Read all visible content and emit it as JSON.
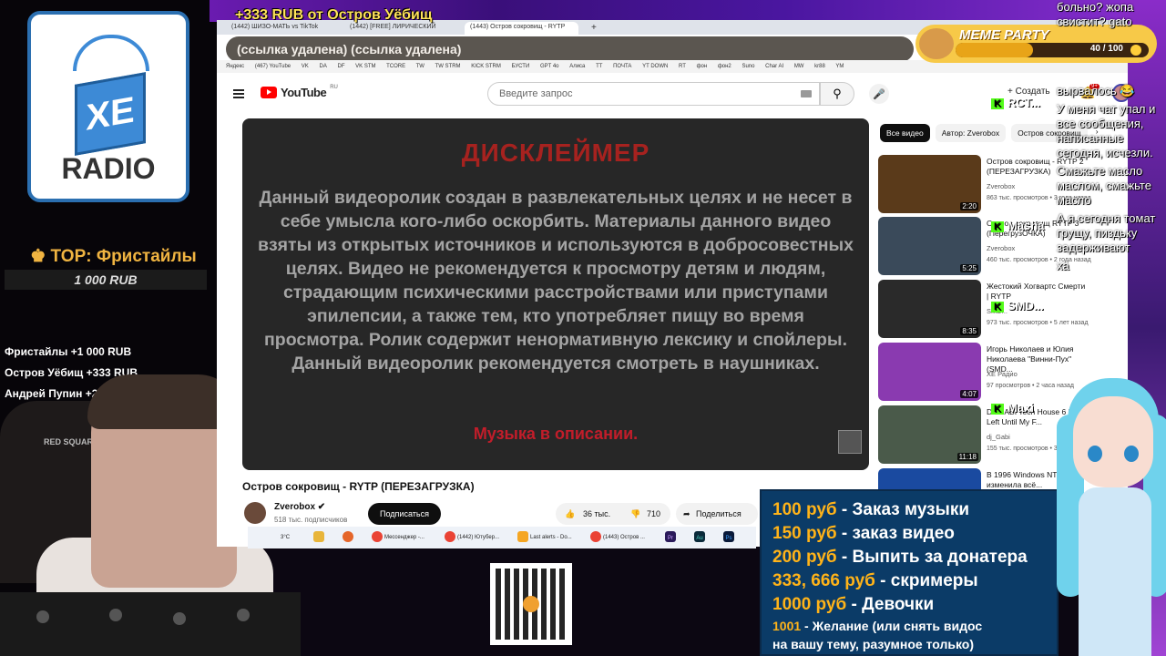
{
  "stream_overlay": {
    "logo": {
      "mark": "XE",
      "text": "RADIO"
    },
    "top_donor": {
      "title": "TOP: Фристайлы",
      "amount": "1 000 RUB"
    },
    "recent_donations": [
      "Фристайлы +1 000 RUB",
      "Остров Уёбищ +333 RUB",
      "Андрей Пупин +20"
    ],
    "chair_brand": "RED SQUARE",
    "donate_banner": "+333 RUB  от Остров Уёбищ",
    "meme_party": {
      "title": "MEME PARTY",
      "value": "40 / 100",
      "progress": 0.4
    },
    "price_list": [
      {
        "price": "100 руб",
        "text": " - Заказ музыки"
      },
      {
        "price": "150 руб",
        "text": " - заказ видео"
      },
      {
        "price": "200 руб",
        "text": " - Выпить за донатера"
      },
      {
        "price": "333, 666 руб",
        "text": " - скримеры"
      },
      {
        "price": "1000 руб",
        "text": " - Девочки"
      },
      {
        "price": "1001",
        "text": " - Желание (или снять видос"
      },
      {
        "price": "",
        "text": "на вашу тему, разумное только)"
      }
    ],
    "chat_messages": [
      "больно? жопа свистит? gato",
      "вырвалось 😂",
      "У меня чат упал и все сообщения, написанные сегодня, исчезли.",
      "Смажьте масло маслом, смажьте масло",
      "А я сегодня томат грущу, пиздьку задерживают",
      "ха"
    ],
    "kick_users": [
      "RCT...",
      "Masha",
      "SMD...",
      "Maxi"
    ]
  },
  "browser": {
    "tabs": [
      {
        "label": "(1442) ШИЗО-МАТЬ vs TikTok",
        "active": false
      },
      {
        "label": "(1442) [FREE] ЛИРИЧЕСКИЙ",
        "active": false
      },
      {
        "label": "(1443) Остров сокровищ - RYTP",
        "active": true
      }
    ],
    "address": "(ссылка удалена) (ссылка удалена)",
    "bookmarks": [
      "Яндекс",
      "(467) YouTube",
      "VK",
      "DA",
      "DF",
      "VK STM",
      "TCORE",
      "TW",
      "TW STRM",
      "KICK STRM",
      "БУСТИ",
      "GPT 4o",
      "Алиса",
      "TT",
      "ПОЧТА",
      "YT DOWN",
      "RT",
      "фон",
      "фон2",
      "Suno",
      "Char AI",
      "MW",
      "kr88",
      "YM"
    ]
  },
  "youtube": {
    "logo_text": "YouTube",
    "region": "RU",
    "search_placeholder": "Введите запрос",
    "create_label": "Создать",
    "notifications": "9+",
    "video": {
      "disclaimer_title": "ДИСКЛЕЙМЕР",
      "disclaimer_text": "Данный видеоролик создан в развлекательных целях и не несет в себе умысла кого-либо оскорбить. Материалы данного видео взяты из открытых источников и используются в добросовестных целях. Видео не рекомендуется к просмотру детям и людям, страдающим психическими расстройствами или приступами эпилепсии, а также тем, кто употребляет пищу во время просмотра. Ролик содержит ненормативную лексику и спойлеры. Данный видеоролик рекомендуется смотреть в наушниках.",
      "disclaimer_music": "Музыка в описании.",
      "title": "Остров сокровищ - RYTP (ПЕРЕЗАГРУЗКА)",
      "channel": "Zverobox",
      "subscribers": "518 тыс. подписчиков",
      "subscribe_label": "Подписаться",
      "likes": "36 тыс.",
      "dislikes": "710",
      "share_label": "Поделиться"
    },
    "chips": [
      {
        "label": "Все видео",
        "active": true
      },
      {
        "label": "Автор: Zverobox",
        "active": false
      },
      {
        "label": "Остров сокровищ",
        "active": false
      }
    ],
    "recommendations": [
      {
        "title": "Остров сокровищ - RYTP 2 (ПЕРЕЗАГРУЗКА)",
        "channel": "Zverobox",
        "meta": "863 тыс. просмотров • 3 года назад",
        "duration": "2:20",
        "color": "#5a3a1a"
      },
      {
        "title": "Остров сокровищ RYTP 3 (ПерегрузОЧКА)",
        "channel": "Zverobox",
        "meta": "460 тыс. просмотров • 2 года назад",
        "duration": "5:25",
        "color": "#3a4a5a"
      },
      {
        "title": "Жестокий Хогвартс Смерти | RYTP",
        "channel": "SMD...",
        "meta": "973 тыс. просмотров • 5 лет назад",
        "duration": "8:35",
        "color": "#2a2a2a"
      },
      {
        "title": "Игорь Николаев и Юлия Николаева \"Винни-Пух\" (SMD...",
        "channel": "XE Радио",
        "meta": "97 просмотров • 2 часа назад",
        "duration": "4:07",
        "color": "#8a3ab0"
      },
      {
        "title": "DJ GABI Tech House 6 Days Left Until My F...",
        "channel": "dj_Gabi",
        "meta": "155 тыс. просмотров • 3 года назад",
        "duration": "11:18",
        "color": "#4a5a4a"
      },
      {
        "title": "В 1996 Windows NT 4.0 изменила всё...",
        "channel": "",
        "meta": "",
        "duration": "",
        "color": "#1a4aa0"
      }
    ]
  },
  "taskbar": {
    "weather": "3°C",
    "items": [
      "Мессенджер -...",
      "(1442) Ютубер...",
      "Last alerts - Do...",
      "(1443) Остров ..."
    ],
    "apps": [
      "Pr",
      "Au",
      "Ps"
    ]
  }
}
